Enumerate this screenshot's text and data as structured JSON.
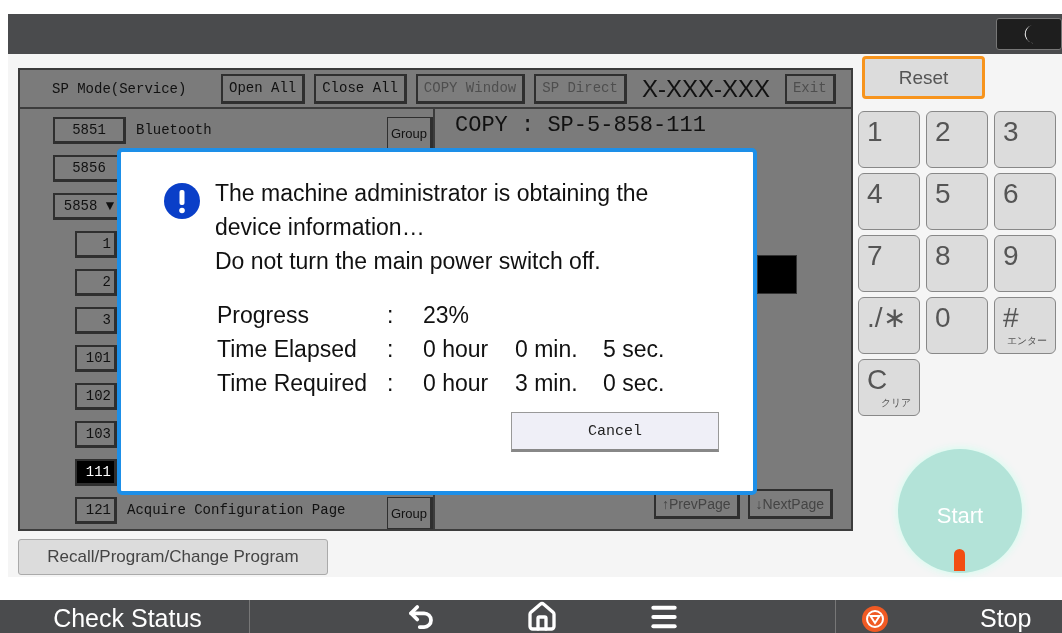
{
  "sp_panel": {
    "title": "SP Mode(Service)",
    "header_buttons": [
      {
        "label": "Open All",
        "disabled": false
      },
      {
        "label": "Close All",
        "disabled": false
      },
      {
        "label": "COPY Window",
        "disabled": true
      },
      {
        "label": "SP Direct",
        "disabled": true
      }
    ],
    "code": "X-XXX-XXX",
    "exit_button": {
      "label": "Exit",
      "disabled": true
    },
    "items": [
      {
        "number": "5851",
        "name": "Bluetooth",
        "group": "Group",
        "selected": false
      },
      {
        "number": "5856",
        "selected": false
      },
      {
        "number": "5858 ▼",
        "selected": false,
        "children": [
          {
            "number": "1",
            "selected": false
          },
          {
            "number": "2",
            "selected": false
          },
          {
            "number": "3",
            "selected": false
          },
          {
            "number": "101",
            "selected": false
          },
          {
            "number": "102",
            "selected": false
          },
          {
            "number": "103",
            "selected": false
          },
          {
            "number": "111",
            "selected": true
          },
          {
            "number": "121",
            "name": "Acquire Configuration Page",
            "group": "Group",
            "selected": false
          }
        ]
      }
    ],
    "detail_title": "COPY : SP-5-858-111",
    "prev_page": "↑PrevPage",
    "next_page": "↓NextPage"
  },
  "recall_button": "Recall/Program/Change Program",
  "dialog": {
    "message_lines": [
      "The machine administrator is obtaining the",
      "device information…",
      "Do not turn the main power switch off."
    ],
    "rows": [
      {
        "label": "Progress",
        "separator": ":",
        "values": [
          "23%"
        ]
      },
      {
        "label": "Time Elapsed",
        "separator": ":",
        "values": [
          "0 hour",
          "0 min.",
          "5 sec."
        ]
      },
      {
        "label": "Time Required",
        "separator": ":",
        "values": [
          "0 hour",
          "3 min.",
          "0 sec."
        ]
      }
    ],
    "cancel_button": "Cancel"
  },
  "reset_button": "Reset",
  "keypad": [
    {
      "main": "1"
    },
    {
      "main": "2"
    },
    {
      "main": "3"
    },
    {
      "main": "4"
    },
    {
      "main": "5"
    },
    {
      "main": "6"
    },
    {
      "main": "7"
    },
    {
      "main": "8"
    },
    {
      "main": "9"
    },
    {
      "main": "./∗"
    },
    {
      "main": "0"
    },
    {
      "main": "#",
      "sub": "エンター"
    },
    {
      "main": "C",
      "sub": "クリア"
    }
  ],
  "start_button": "Start",
  "bottom_bar": {
    "check_status": "Check Status",
    "stop": "Stop"
  }
}
